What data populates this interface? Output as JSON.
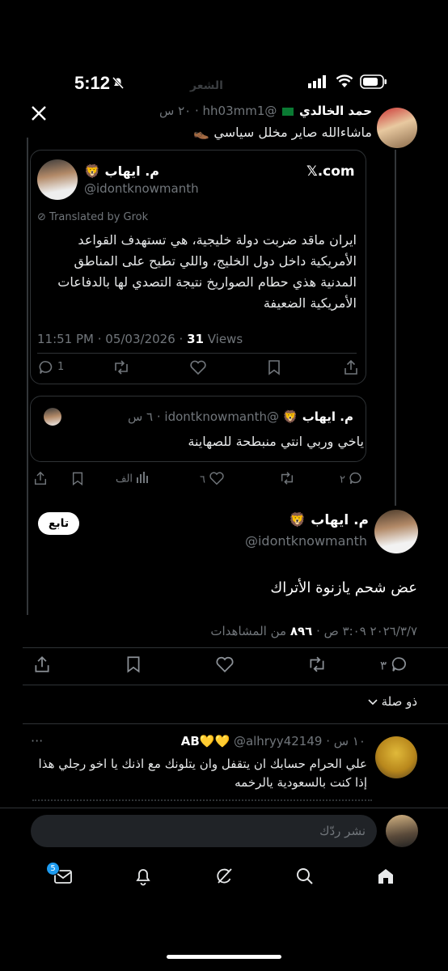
{
  "status_bar": {
    "time": "5:12"
  },
  "top": {
    "faded_title": "الشعر",
    "x_logo": "𝕏"
  },
  "parent_tweet": {
    "name": "حمد الخالدي",
    "handle": "@hh03mm1",
    "time": "٢٠ س",
    "text": "ماشاءالله صاير مخلل سياسي 👞"
  },
  "embedded_card": {
    "name": "م. ايهاب 🦁",
    "handle": "@idontknowmanth",
    "site": "𝕏.com",
    "translated": "Translated by Grok",
    "body": "ايران ماقد ضربت دولة خليجية، هي تستهدف القواعد الأمريكية داخل دول الخليج، واللي تطيح على المناطق المدنية هذي حطام الصواريخ نتيجة التصدي لها بالدفاعات الأمريكية الضعيفة",
    "meta_time": "11:51 PM · 05/03/2026 ·",
    "views_count": "31",
    "views_label": "Views",
    "reply_count": "1"
  },
  "quoted_reply": {
    "name": "م. ايهاب 🦁",
    "handle": "@idontknowmanth",
    "time": "٦ س",
    "text": "ياخي وربي انتي منبطحة للصهاينة"
  },
  "parent_actions": {
    "replies": "٢",
    "likes": "٦",
    "views": "الف"
  },
  "main_tweet": {
    "name": "م. ايهاب 🦁",
    "handle": "@idontknowmanth",
    "follow": "تابع",
    "text": "عض شحم يازنوة الأتراك",
    "timestamp": "٢٠٢٦/٣/٧ ٣:٠٩ ص ·",
    "views_count": "٨٩٦",
    "views_label": "من المشاهدات",
    "replies": "٣"
  },
  "sort_label": "ذو صلة",
  "reply_tweet": {
    "name": "AB💛💛",
    "handle": "@alhryy42149",
    "time": "١٠ س",
    "more": "···",
    "text": "علي الحرام حسابك ان يتقفل وان يتلونك مع اذنك يا اخو رجلي هذا إذا كنت بالسعودية يالرخمه"
  },
  "composer": {
    "placeholder": "نشر ردّك"
  },
  "tab_bar": {
    "badge": "5"
  },
  "colors": {
    "accent": "#1d9bf0",
    "muted": "#71767b",
    "border": "#2f3336"
  }
}
